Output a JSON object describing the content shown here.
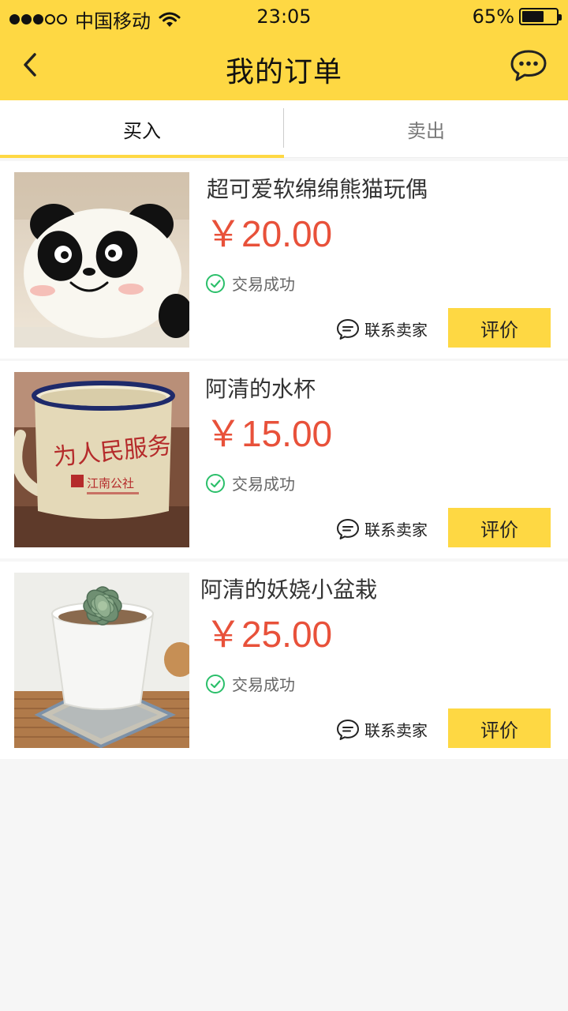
{
  "status_bar": {
    "carrier": "中国移动",
    "time": "23:05",
    "battery": "65%",
    "battery_level": 0.65,
    "signal_bars": 3
  },
  "nav": {
    "title": "我的订单",
    "back_icon": "chevron-left-icon",
    "message_icon": "chat-bubble-icon"
  },
  "tabs": [
    {
      "label": "买入",
      "active": true
    },
    {
      "label": "卖出",
      "active": false
    }
  ],
  "orders": [
    {
      "title": "超可爱软绵绵熊猫玩偶",
      "price": "￥20.00",
      "status": "交易成功",
      "contact_label": "联系卖家",
      "review_label": "评价",
      "image": "panda-plush-image"
    },
    {
      "title": "阿清的水杯",
      "price": "￥15.00",
      "status": "交易成功",
      "contact_label": "联系卖家",
      "review_label": "评价",
      "image": "enamel-mug-image",
      "image_text_1": "为人民服务",
      "image_text_2": "江南公社"
    },
    {
      "title": "阿清的妖娆小盆栽",
      "price": "￥25.00",
      "status": "交易成功",
      "contact_label": "联系卖家",
      "review_label": "评价",
      "image": "succulent-pot-image"
    }
  ],
  "colors": {
    "accent": "#fed843",
    "price": "#e8513a",
    "success": "#2bbf6a",
    "background": "#f6f6f6"
  }
}
